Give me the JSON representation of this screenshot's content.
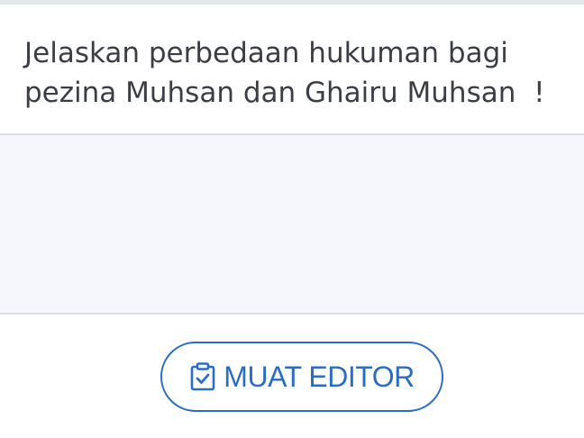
{
  "question": {
    "text": "Jelaskan perbedaan hukuman bagi\npezina Muhsan dan Ghairu Muhsan  !"
  },
  "answer": {
    "value": ""
  },
  "editor_button": {
    "icon": "clipboard-check-icon",
    "label": "MUAT EDITOR",
    "color": "#2b6cc4"
  }
}
